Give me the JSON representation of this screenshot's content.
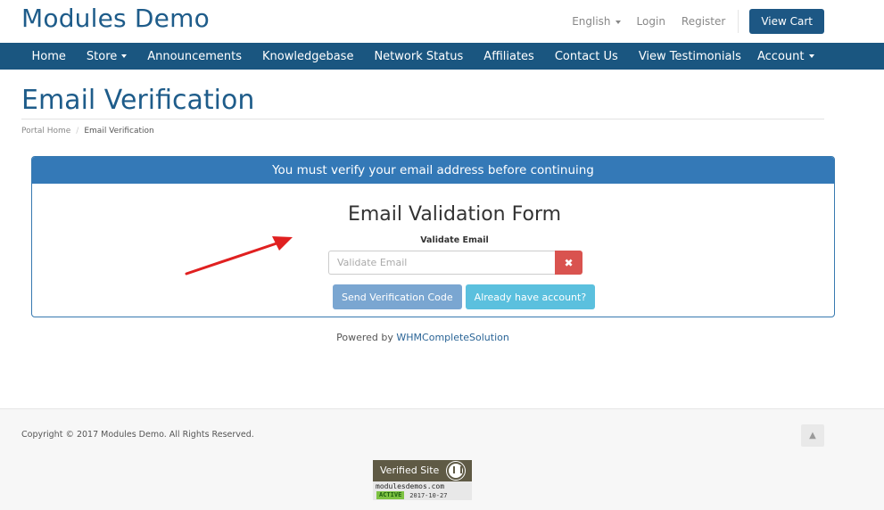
{
  "header": {
    "brand": "Modules Demo",
    "language": "English",
    "login": "Login",
    "register": "Register",
    "view_cart": "View Cart"
  },
  "nav": {
    "items": [
      {
        "label": "Home"
      },
      {
        "label": "Store",
        "dropdown": true
      },
      {
        "label": "Announcements"
      },
      {
        "label": "Knowledgebase"
      },
      {
        "label": "Network Status"
      },
      {
        "label": "Affiliates"
      },
      {
        "label": "Contact Us"
      },
      {
        "label": "View Testimonials"
      }
    ],
    "account": "Account"
  },
  "page": {
    "title": "Email Verification",
    "breadcrumb": [
      "Portal Home",
      "Email Verification"
    ]
  },
  "panel": {
    "heading": "You must verify your email address before continuing",
    "form_title": "Email Validation Form",
    "field_label": "Validate Email",
    "field_placeholder": "Validate Email",
    "field_value": "",
    "clear_icon": "times-icon",
    "send_button": "Send Verification Code",
    "have_account_button": "Already have account?"
  },
  "powered": {
    "prefix": "Powered by",
    "link": "WHMCompleteSolution"
  },
  "footer": {
    "copyright": "Copyright © 2017 Modules Demo. All Rights Reserved.",
    "back_to_top_icon": "chevron-up-icon",
    "badge": {
      "title": "Verified Site",
      "domain": "modulesdemos.com",
      "status": "ACTIVE",
      "date": "2017-10-27"
    }
  },
  "colors": {
    "brand": "#1e5c8a",
    "navbar": "#1a5680",
    "panel_head": "#3479b7",
    "danger": "#d9534f",
    "info": "#5bc0de",
    "annotation_arrow": "#e02020"
  }
}
